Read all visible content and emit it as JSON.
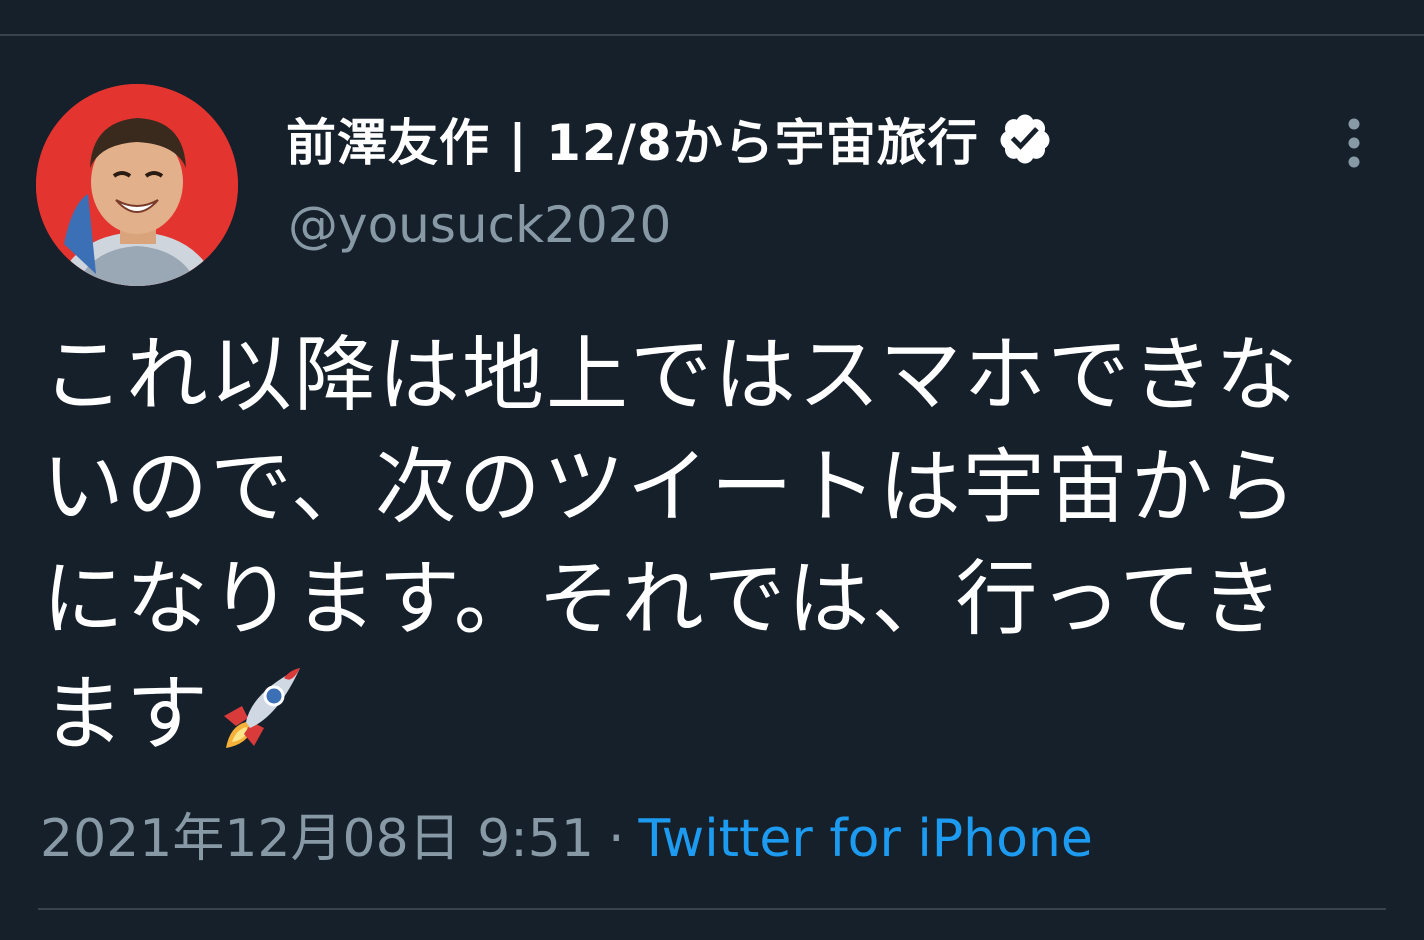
{
  "tweet": {
    "display_name": "前澤友作 | 12/8から宇宙旅行",
    "handle": "@yousuck2020",
    "text_lines": [
      "これ以降は地上ではスマホできな",
      "いので、次のツイートは宇宙から",
      "になります。それでは、行ってき",
      "ます"
    ],
    "timestamp": "2021年12月08日 9:51",
    "separator": "·",
    "source": "Twitter for iPhone"
  },
  "icons": {
    "verified": "verified-badge-icon",
    "more": "more-vertical-icon",
    "rocket": "rocket-emoji-icon"
  },
  "colors": {
    "background": "#15202b",
    "muted_text": "#8899a6",
    "link": "#1d9bf0",
    "divider": "#38444d",
    "avatar_bg": "#e3342f"
  }
}
